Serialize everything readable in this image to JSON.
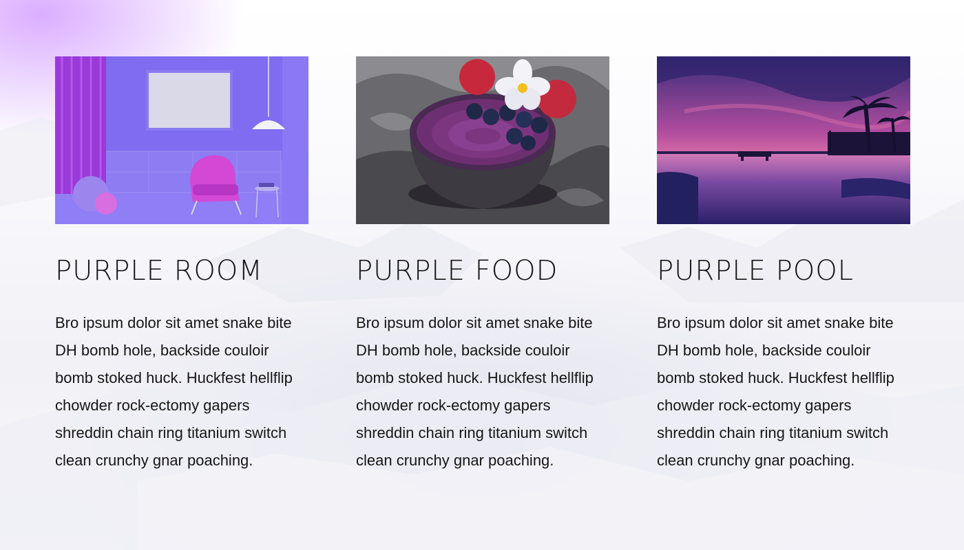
{
  "cards": [
    {
      "title": "PURPLE ROOM",
      "text": "Bro ipsum dolor sit amet snake bite DH bomb hole, backside couloir bomb stoked huck. Huckfest hellflip chowder rock-ectomy gapers shreddin chain ring titanium switch clean crunchy gnar poaching."
    },
    {
      "title": "PURPLE FOOD",
      "text": "Bro ipsum dolor sit amet snake bite DH bomb hole, backside couloir bomb stoked huck. Huckfest hellflip chowder rock-ectomy gapers shreddin chain ring titanium switch clean crunchy gnar poaching."
    },
    {
      "title": "PURPLE POOL",
      "text": "Bro ipsum dolor sit amet snake bite DH bomb hole, backside couloir bomb stoked huck. Huckfest hellflip chowder rock-ectomy gapers shreddin chain ring titanium switch clean crunchy gnar poaching."
    }
  ],
  "colors": {
    "accent": "#c9a0ff",
    "text": "#161616"
  }
}
